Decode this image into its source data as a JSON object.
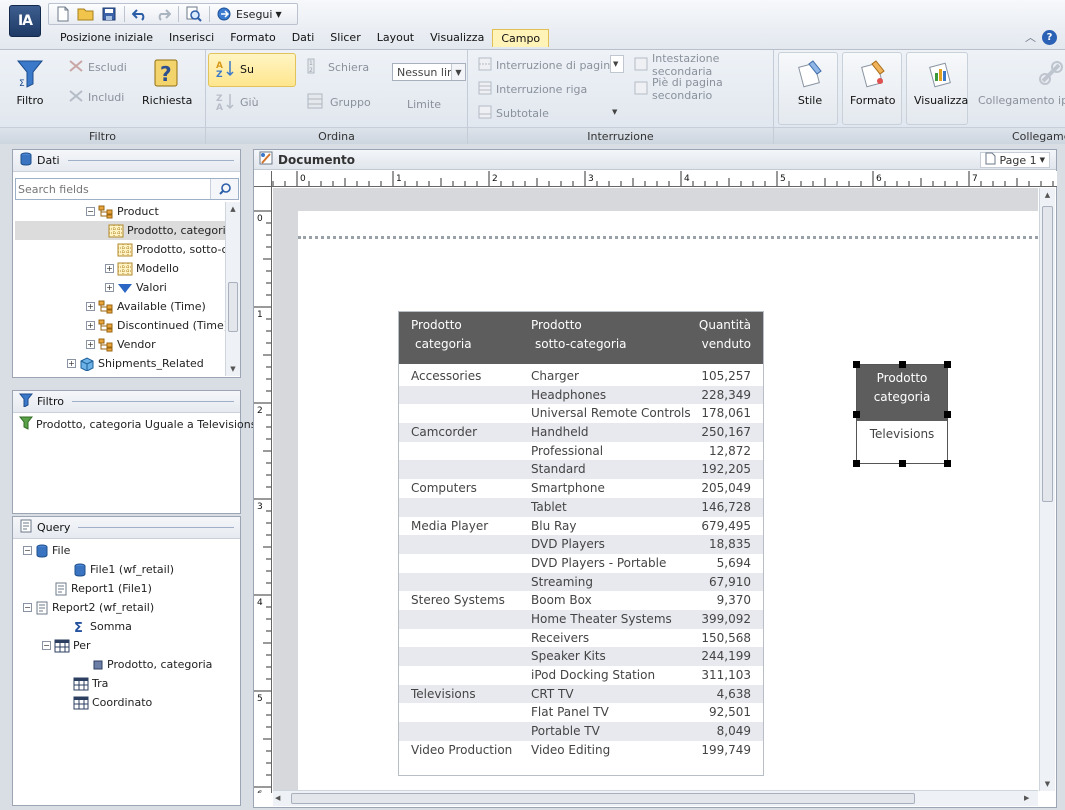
{
  "app": {
    "logo": "IA",
    "run_label": "Esegui"
  },
  "menu": {
    "items": [
      "Posizione iniziale",
      "Inserisci",
      "Formato",
      "Dati",
      "Slicer",
      "Layout",
      "Visualizza",
      "Campo"
    ],
    "active": "Campo"
  },
  "ribbon": {
    "filtro": {
      "label": "Filtro",
      "filtro_btn": "Filtro",
      "escludi": "Escludi",
      "includi": "Includi",
      "richiesta": "Richiesta"
    },
    "ordina": {
      "label": "Ordina",
      "su": "Su",
      "giu": "Giù",
      "schiera": "Schiera",
      "gruppo": "Gruppo",
      "limite_value": "Nessun lir",
      "limite": "Limite"
    },
    "interruzione": {
      "label": "Interruzione",
      "pagina": "Interruzione di pagina",
      "riga": "Interruzione riga",
      "subtotale": "Subtotale",
      "intestazione": "Intestazione secondaria",
      "piede": "Piè di pagina secondario"
    },
    "stile": "Stile",
    "formato": "Formato",
    "visualizza": "Visualizza",
    "collegamento": {
      "btn": "Collegamento ipe",
      "label": "Collegame"
    }
  },
  "dati": {
    "title": "Dati",
    "search_placeholder": "Search fields",
    "tree": [
      {
        "label": "Product",
        "level": 3,
        "pm": "−",
        "icon": "folder-hierarchy-icon"
      },
      {
        "label": "Prodotto, categoria",
        "level": 4,
        "icon": "dimension-grid-icon",
        "selected": true
      },
      {
        "label": "Prodotto, sotto-categoria",
        "level": 4,
        "icon": "dimension-grid-icon"
      },
      {
        "label": "Modello",
        "level": 4,
        "pm": "+",
        "icon": "dimension-grid-icon"
      },
      {
        "label": "Valori",
        "level": 4,
        "pm": "+",
        "icon": "measure-triangle-icon"
      },
      {
        "label": "Available (Time)",
        "level": 3,
        "pm": "+",
        "icon": "folder-hierarchy-icon"
      },
      {
        "label": "Discontinued (Time)",
        "level": 3,
        "pm": "+",
        "icon": "folder-hierarchy-icon"
      },
      {
        "label": "Vendor",
        "level": 3,
        "pm": "+",
        "icon": "folder-hierarchy-icon"
      },
      {
        "label": "Shipments_Related",
        "level": 2,
        "pm": "+",
        "icon": "cube-icon"
      }
    ]
  },
  "filtro": {
    "title": "Filtro",
    "item": "Prodotto, categoria Uguale a Televisions"
  },
  "query": {
    "title": "Query",
    "tree": [
      {
        "label": "File",
        "level": 0,
        "pm": "−",
        "icon": "database-icon"
      },
      {
        "label": "File1 (wf_retail)",
        "level": 2,
        "icon": "database-icon"
      },
      {
        "label": "Report1 (File1)",
        "level": 1,
        "icon": "report-icon"
      },
      {
        "label": "Report2 (wf_retail)",
        "level": 0,
        "pm": "−",
        "icon": "report-icon"
      },
      {
        "label": "Somma",
        "level": 2,
        "icon": "sum-icon"
      },
      {
        "label": "Per",
        "level": 1,
        "pm": "−",
        "icon": "grid-icon"
      },
      {
        "label": "Prodotto, categoria",
        "level": 3,
        "icon": "field-icon"
      },
      {
        "label": "Tra",
        "level": 2,
        "icon": "grid-icon"
      },
      {
        "label": "Coordinato",
        "level": 2,
        "icon": "grid-icon"
      }
    ]
  },
  "document": {
    "title": "Documento",
    "page_label": "Page 1",
    "ruler_h": [
      "0",
      "1",
      "2",
      "3",
      "4",
      "5",
      "6",
      "7"
    ],
    "ruler_v": [
      "0",
      "1",
      "2",
      "3",
      "4",
      "5",
      "6"
    ]
  },
  "report": {
    "headers": [
      [
        "Prodotto",
        "categoria"
      ],
      [
        "Prodotto",
        "sotto-categoria"
      ],
      [
        "Quantità",
        "venduto"
      ]
    ],
    "rows": [
      [
        "Accessories",
        "Charger",
        "105,257"
      ],
      [
        "",
        "Headphones",
        "228,349"
      ],
      [
        "",
        "Universal Remote Controls",
        "178,061"
      ],
      [
        "Camcorder",
        "Handheld",
        "250,167"
      ],
      [
        "",
        "Professional",
        "12,872"
      ],
      [
        "",
        "Standard",
        "192,205"
      ],
      [
        "Computers",
        "Smartphone",
        "205,049"
      ],
      [
        "",
        "Tablet",
        "146,728"
      ],
      [
        "Media Player",
        "Blu Ray",
        "679,495"
      ],
      [
        "",
        "DVD Players",
        "18,835"
      ],
      [
        "",
        "DVD Players - Portable",
        "5,694"
      ],
      [
        "",
        "Streaming",
        "67,910"
      ],
      [
        "Stereo Systems",
        "Boom Box",
        "9,370"
      ],
      [
        "",
        "Home Theater Systems",
        "399,092"
      ],
      [
        "",
        "Receivers",
        "150,568"
      ],
      [
        "",
        "Speaker Kits",
        "244,199"
      ],
      [
        "",
        "iPod Docking Station",
        "311,103"
      ],
      [
        "Televisions",
        "CRT TV",
        "4,638"
      ],
      [
        "",
        "Flat Panel TV",
        "92,501"
      ],
      [
        "",
        "Portable TV",
        "8,049"
      ],
      [
        "Video Production",
        "Video Editing",
        "199,749"
      ]
    ]
  },
  "report2": {
    "header": [
      "Prodotto",
      "categoria"
    ],
    "value": "Televisions"
  }
}
